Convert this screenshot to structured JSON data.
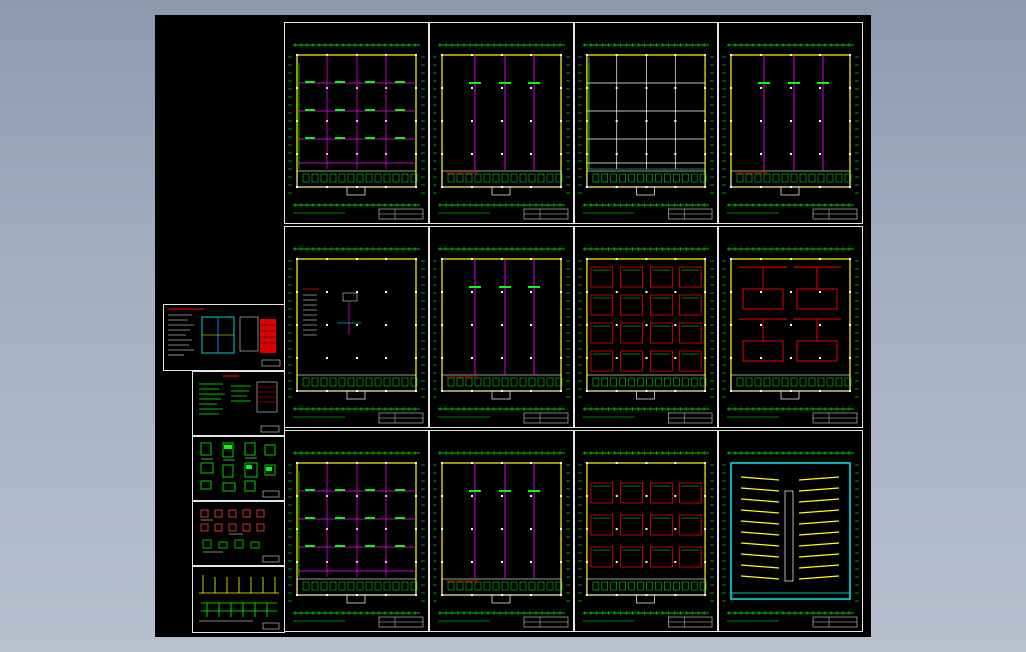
{
  "viewer": {
    "background": "#000000",
    "frame_color": "#e6e6e6"
  },
  "palette": {
    "green": "#00ff00",
    "yellow": "#ffff00",
    "magenta": "#ff00ff",
    "red": "#ff0000",
    "cyan": "#00ffff",
    "white": "#ffffff",
    "blue": "#3399ff"
  },
  "sheets": [
    {
      "id": "sheet-1",
      "pattern": "grid-magenta"
    },
    {
      "id": "sheet-2",
      "pattern": "vertical-magenta"
    },
    {
      "id": "sheet-3",
      "pattern": "grid-white"
    },
    {
      "id": "sheet-4",
      "pattern": "vertical-magenta"
    },
    {
      "id": "sheet-5",
      "pattern": "empty-notes"
    },
    {
      "id": "sheet-6",
      "pattern": "vertical-magenta"
    },
    {
      "id": "sheet-7",
      "pattern": "grid-red"
    },
    {
      "id": "sheet-8",
      "pattern": "red-blocks"
    },
    {
      "id": "sheet-9",
      "pattern": "grid-magenta"
    },
    {
      "id": "sheet-10",
      "pattern": "vertical-magenta"
    },
    {
      "id": "sheet-11",
      "pattern": "grid-red-sparse"
    },
    {
      "id": "sheet-12",
      "pattern": "cyan-lighting"
    }
  ],
  "detail_sheets": [
    {
      "id": "legend-sheet"
    },
    {
      "id": "notes-sheet"
    },
    {
      "id": "detail-sheet-a"
    },
    {
      "id": "detail-sheet-b"
    },
    {
      "id": "system-diagram-sheet"
    }
  ]
}
